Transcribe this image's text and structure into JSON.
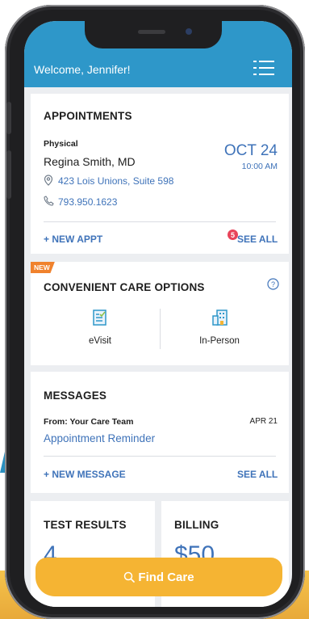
{
  "header": {
    "welcome": "Welcome, Jennifer!"
  },
  "appointments": {
    "title": "APPOINTMENTS",
    "type": "Physical",
    "doctor": "Regina Smith, MD",
    "address": "423 Lois Unions, Suite 598",
    "phone": "793.950.1623",
    "date": "OCT 24",
    "time": "10:00 AM",
    "new_appt": "+ NEW APPT",
    "badge_count": "5",
    "see_all": "SEE ALL"
  },
  "care_options": {
    "new_badge": "NEW",
    "title": "CONVENIENT CARE OPTIONS",
    "evisit": "eVisit",
    "in_person": "In-Person"
  },
  "messages": {
    "title": "MESSAGES",
    "from": "From: Your Care Team",
    "date": "APR 21",
    "subject": "Appointment Reminder",
    "new_message": "+ NEW MESSAGE",
    "see_all": "SEE ALL"
  },
  "test_results": {
    "title": "TEST RESULTS",
    "value": "4"
  },
  "billing": {
    "title": "BILLING",
    "value": "$50"
  },
  "find_care": {
    "label": "Find Care"
  },
  "colors": {
    "header_blue": "#2e97c9",
    "link_blue": "#3f73b9",
    "badge_red": "#e8445a",
    "new_orange": "#f0822d",
    "find_care_yellow": "#f5b433"
  }
}
